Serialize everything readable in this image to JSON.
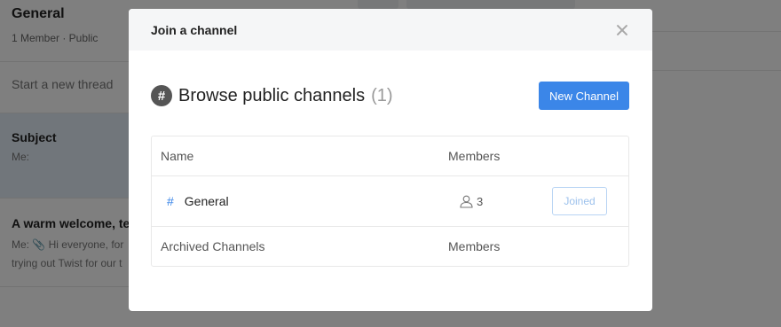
{
  "background": {
    "channel": {
      "title": "General",
      "subtitle": "1 Member · Public"
    },
    "new_thread": "Start a new thread",
    "threads": [
      {
        "title": "Subject",
        "snippet": "Me:"
      },
      {
        "title": "A warm welcome, te",
        "snippet_line1": "Me: 📎 Hi everyone, for",
        "snippet_line2": "trying out Twist for our t"
      }
    ]
  },
  "modal": {
    "title": "Join a channel",
    "browse_title": "Browse public channels",
    "browse_count": "(1)",
    "new_channel_label": "New Channel",
    "table": {
      "header_name": "Name",
      "header_members": "Members",
      "channels": [
        {
          "name": "General",
          "members": "3",
          "status": "Joined"
        }
      ],
      "archived_label": "Archived Channels",
      "archived_members_label": "Members"
    }
  },
  "colors": {
    "accent": "#3b86e8",
    "overlay": "rgba(0,0,0,0.5)"
  }
}
